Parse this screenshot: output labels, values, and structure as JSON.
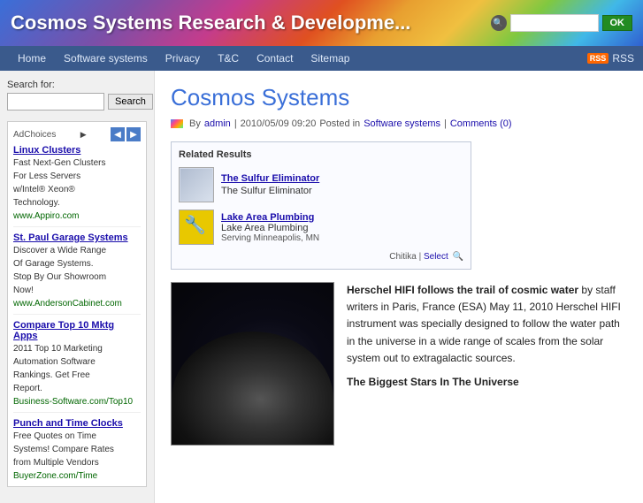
{
  "header": {
    "title": "Cosmos Systems Research & Developme...",
    "search_placeholder": "",
    "search_btn": "OK"
  },
  "navbar": {
    "items": [
      {
        "label": "Home",
        "href": "#"
      },
      {
        "label": "Software systems",
        "href": "#"
      },
      {
        "label": "Privacy",
        "href": "#"
      },
      {
        "label": "T&C",
        "href": "#"
      },
      {
        "label": "Contact",
        "href": "#"
      },
      {
        "label": "Sitemap",
        "href": "#"
      }
    ],
    "rss_label": "RSS"
  },
  "sidebar": {
    "search_label": "Search for:",
    "search_btn": "Search",
    "ad_choices_label": "AdChoices",
    "ads": [
      {
        "title": "Linux Clusters",
        "lines": [
          "Fast Next-Gen Clusters",
          "For Less Servers",
          "w/Intel® Xeon®",
          "Technology.",
          "www.Appiro.com"
        ]
      },
      {
        "title": "St. Paul Garage Systems",
        "lines": [
          "Discover a Wide Range",
          "Of Garage Systems.",
          "Stop By Our Showroom",
          "Now!",
          "www.AndersonCabinet.com"
        ]
      },
      {
        "title": "Compare Top 10 Mktg Apps",
        "lines": [
          "2011 Top 10 Marketing",
          "Automation Software",
          "Rankings. Get Free",
          "Report.",
          "Business-Software.com/Top10"
        ]
      },
      {
        "title": "Punch and Time Clocks",
        "lines": [
          "Free Quotes on Time",
          "Systems! Compare Rates",
          "from Multiple Vendors",
          "BuyerZone.com/Time"
        ]
      }
    ]
  },
  "content": {
    "page_title": "Cosmos Systems",
    "post_meta": {
      "by": "By",
      "author": "admin",
      "date": "2010/05/09 09:20",
      "posted_in": "Posted in",
      "category": "Software systems",
      "comments": "Comments (0)"
    },
    "related": {
      "title": "Related Results",
      "items": [
        {
          "link": "The Sulfur Eliminator",
          "text": "The Sulfur Eliminator"
        },
        {
          "link": "Lake Area Plumbing",
          "text": "Lake Area Plumbing",
          "sub": "Serving Minneapolis, MN"
        }
      ],
      "footer_chitika": "Chitika",
      "footer_select": "Select"
    },
    "article": {
      "bold_intro": "Herschel HIFI follows the trail of cosmic water",
      "intro_rest": " by staff writers in Paris, France (ESA) May 11, 2010 Herschel HIFI instrument was specially designed to follow the water path in the universe in a wide range of scales from the solar system out to extragalactic sources.",
      "subtitle": "The Biggest Stars In The Universe"
    }
  }
}
